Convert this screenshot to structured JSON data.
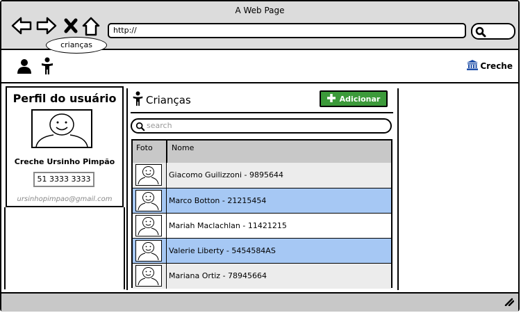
{
  "window": {
    "title": "A Web Page",
    "url": "http://"
  },
  "navbar": {
    "tooltip": "crianças",
    "creche_link": "Creche"
  },
  "profile": {
    "title": "Perfil do usuário",
    "name": "Creche Ursinho Pimpão",
    "phone": "51 3333 3333",
    "email": "ursinhopimpao@gmail.com"
  },
  "section": {
    "title": "Crianças",
    "add_label": "Adicionar",
    "search_placeholder": "search"
  },
  "table": {
    "headers": {
      "photo": "Foto",
      "name": "Nome"
    },
    "rows": [
      {
        "name": "Giacomo Guilizzoni - 9895644",
        "bg": "#ececec"
      },
      {
        "name": "Marco Botton - 21215454",
        "bg": "#a6c8f4"
      },
      {
        "name": "Mariah Maclachlan - 11421215",
        "bg": "#ffffff"
      },
      {
        "name": "Valerie Liberty - 5454584AS",
        "bg": "#a6c8f4"
      },
      {
        "name": "Mariana Ortiz - 78945664",
        "bg": "#ececec"
      }
    ]
  },
  "colors": {
    "accent_green": "#3c9a3a",
    "selected_row": "#a6c8f4",
    "creche_icon": "#1f4fa8"
  }
}
